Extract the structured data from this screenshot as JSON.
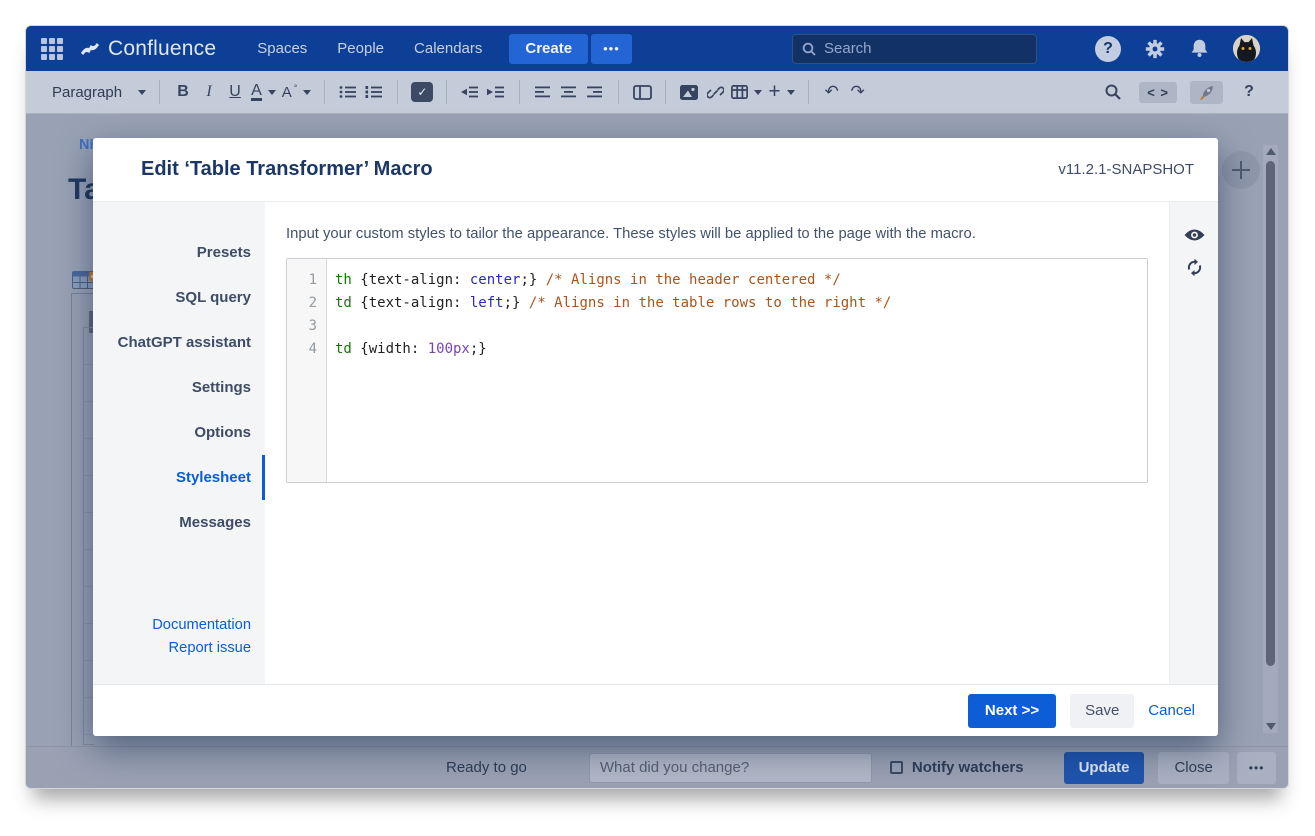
{
  "topnav": {
    "product": "Confluence",
    "nav_items": [
      "Spaces",
      "People",
      "Calendars"
    ],
    "create_label": "Create",
    "more_label": "•••",
    "search_placeholder": "Search",
    "help_label": "?"
  },
  "toolbar": {
    "paragraph_label": "Paragraph",
    "bold_label": "B",
    "italic_label": "I",
    "underline_label": "U",
    "color_label": "A",
    "format_label": "A",
    "plus_label": "+",
    "undo_glyph": "↶",
    "redo_glyph": "↷",
    "source_label": "< >",
    "help_label": "?"
  },
  "page": {
    "breadcrumb": "NK",
    "title_fragment": "Ta"
  },
  "modal": {
    "title": "Edit ‘Table Transformer’ Macro",
    "version": "v11.2.1-SNAPSHOT",
    "tabs": [
      "Presets",
      "SQL query",
      "ChatGPT assistant",
      "Settings",
      "Options",
      "Stylesheet",
      "Messages"
    ],
    "active_tab": "Stylesheet",
    "links": [
      "Documentation",
      "Report issue"
    ],
    "description": "Input your custom styles to tailor the appearance. These styles will be applied to the page with the macro.",
    "editor": {
      "lines": [
        {
          "num": "1",
          "segments": [
            {
              "c": "tag",
              "t": "th"
            },
            {
              "c": "plain",
              "t": " {text-align: "
            },
            {
              "c": "atom",
              "t": "center"
            },
            {
              "c": "plain",
              "t": ";} "
            },
            {
              "c": "comment",
              "t": "/* Aligns in the header centered */"
            }
          ]
        },
        {
          "num": "2",
          "segments": [
            {
              "c": "tag",
              "t": "td"
            },
            {
              "c": "plain",
              "t": " {text-align: "
            },
            {
              "c": "atom",
              "t": "left"
            },
            {
              "c": "plain",
              "t": ";} "
            },
            {
              "c": "comment",
              "t": "/* Aligns in the table rows to the right */"
            }
          ]
        },
        {
          "num": "3",
          "segments": []
        },
        {
          "num": "4",
          "segments": [
            {
              "c": "tag",
              "t": "td"
            },
            {
              "c": "plain",
              "t": " {width: "
            },
            {
              "c": "num",
              "t": "100px"
            },
            {
              "c": "plain",
              "t": ";}"
            }
          ]
        }
      ]
    },
    "footer": {
      "next_label": "Next >>",
      "save_label": "Save",
      "cancel_label": "Cancel"
    }
  },
  "statusbar": {
    "status_text": "Ready to go",
    "comment_placeholder": "What did you change?",
    "notify_label": "Notify watchers",
    "update_label": "Update",
    "close_label": "Close",
    "more_label": "•••"
  },
  "colors": {
    "header_blue": "#0c3f95",
    "primary_blue": "#0c5dd6",
    "active_tab_blue": "#0b5cd7",
    "code_tag_green": "#117a00",
    "code_value_blue": "#2a2ac0",
    "code_number_purple": "#7a43b6",
    "code_comment_orange": "#a9551c"
  }
}
